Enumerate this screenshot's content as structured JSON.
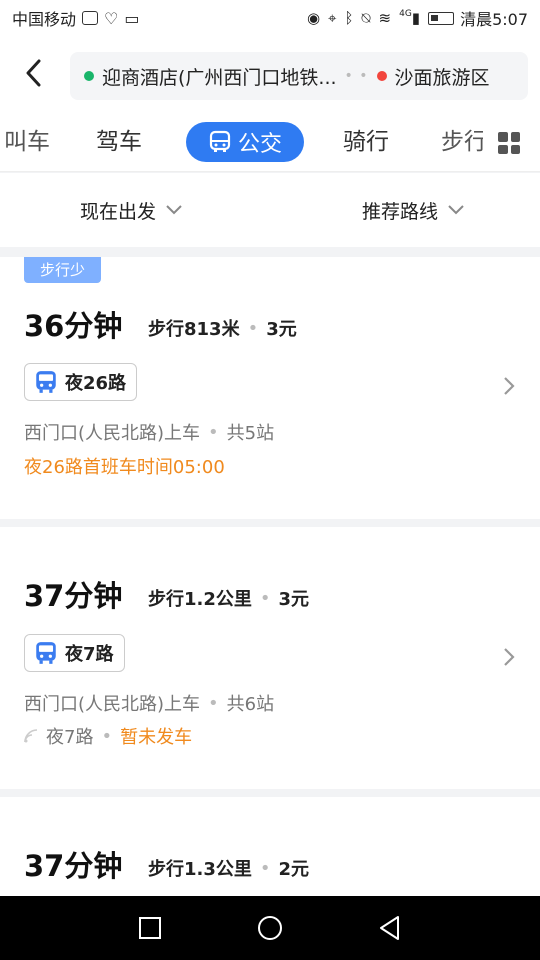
{
  "statusbar": {
    "carrier": "中国移动",
    "network": "4G",
    "time_label": "清晨5:07"
  },
  "header": {
    "from": "迎商酒店(广州西门口地铁...",
    "to": "沙面旅游区",
    "from_dot_color": "#19b56a",
    "to_dot_color": "#f2453d"
  },
  "tabs": {
    "partial_left": "叫车",
    "drive": "驾车",
    "bus": "公交",
    "ride": "骑行",
    "walk": "步行",
    "accent": "#2f7bf2"
  },
  "filters": {
    "depart": "现在出发",
    "route_pref": "推荐路线"
  },
  "routes": [
    {
      "badge": "步行少",
      "duration": "36分钟",
      "walk": "步行813米",
      "price": "3元",
      "line": "夜26路",
      "stop": "西门口(人民北路)上车",
      "stops_count": "共5站",
      "note": "夜26路首班车时间05:00"
    },
    {
      "duration": "37分钟",
      "walk": "步行1.2公里",
      "price": "3元",
      "line": "夜7路",
      "stop": "西门口(人民北路)上车",
      "stops_count": "共6站",
      "status_line": "夜7路",
      "status_text": "暂未发车"
    },
    {
      "duration": "37分钟",
      "walk": "步行1.3公里",
      "price": "2元"
    }
  ]
}
